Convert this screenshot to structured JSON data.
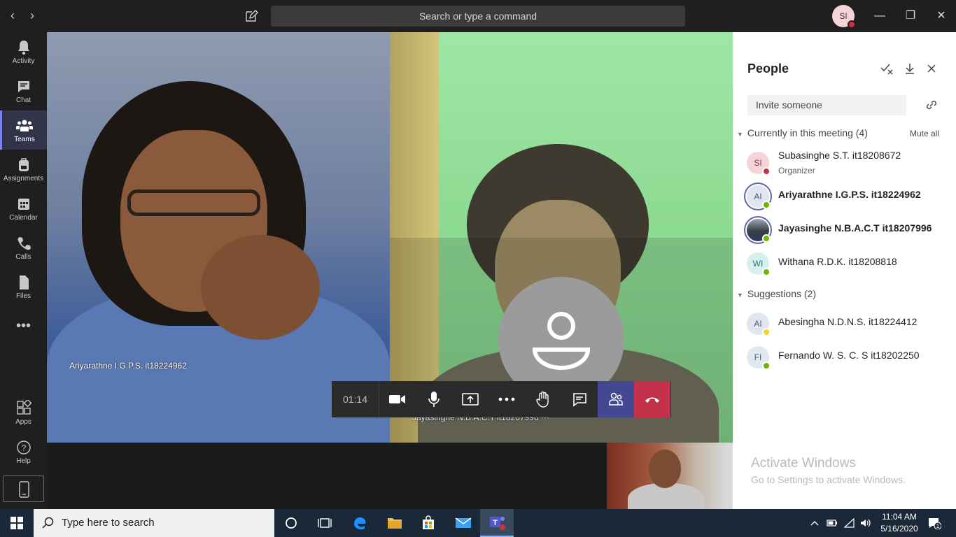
{
  "titlebar": {
    "search_placeholder": "Search or type a command",
    "user_initials": "SI"
  },
  "rail": {
    "items": [
      {
        "label": "Activity",
        "icon": "bell-icon"
      },
      {
        "label": "Chat",
        "icon": "chat-icon"
      },
      {
        "label": "Teams",
        "icon": "teams-icon"
      },
      {
        "label": "Assignments",
        "icon": "backpack-icon"
      },
      {
        "label": "Calendar",
        "icon": "calendar-icon"
      },
      {
        "label": "Calls",
        "icon": "phone-icon"
      },
      {
        "label": "Files",
        "icon": "file-icon"
      },
      {
        "label": "Apps",
        "icon": "apps-icon"
      },
      {
        "label": "Help",
        "icon": "help-icon"
      }
    ]
  },
  "stage": {
    "left_video_name": "Ariyarathne I.G.P.S. it18224962",
    "right_video_name": "Jayasinghe N.B.A.C.T it18207996"
  },
  "controls": {
    "timer": "01:14"
  },
  "people_panel": {
    "title": "People",
    "invite_placeholder": "Invite someone",
    "current_section": "Currently in this meeting (4)",
    "mute_all": "Mute all",
    "suggestions_section": "Suggestions (2)",
    "participants": [
      {
        "initials": "SI",
        "name": "Subasinghe S.T. it18208672",
        "role": "Organizer",
        "status": "busy",
        "status_color": "#c4314b",
        "avatar_bg": "#f4d4d8",
        "avatar_fg": "#8a3a45"
      },
      {
        "initials": "AI",
        "name": "Ariyarathne I.G.P.S. it18224962",
        "role": "",
        "status": "available",
        "status_color": "#6bb700",
        "avatar_bg": "#e1e5ee",
        "avatar_fg": "#4a5a7a"
      },
      {
        "initials": "",
        "name": "Jayasinghe N.B.A.C.T it18207996",
        "role": "",
        "status": "available",
        "status_color": "#6bb700",
        "avatar_bg": "#5a6f8e",
        "avatar_fg": "#ffffff"
      },
      {
        "initials": "WI",
        "name": "Withana R.D.K. it18208818",
        "role": "",
        "status": "available",
        "status_color": "#6bb700",
        "avatar_bg": "#d7f0ee",
        "avatar_fg": "#2a7a72"
      }
    ],
    "suggestions": [
      {
        "initials": "AI",
        "name": "Abesingha N.D.N.S. it18224412",
        "status": "away",
        "status_color": "#f8d22a",
        "avatar_bg": "#e1e5ee",
        "avatar_fg": "#4a5a7a"
      },
      {
        "initials": "FI",
        "name": "Fernando W. S. C. S it18202250",
        "status": "available",
        "status_color": "#6bb700",
        "avatar_bg": "#e1e9ef",
        "avatar_fg": "#4a6a82"
      }
    ]
  },
  "watermark": {
    "line1": "Activate Windows",
    "line2": "Go to Settings to activate Windows."
  },
  "taskbar": {
    "search_placeholder": "Type here to search",
    "time": "11:04 AM",
    "date": "5/16/2020",
    "notification_count": "1"
  }
}
